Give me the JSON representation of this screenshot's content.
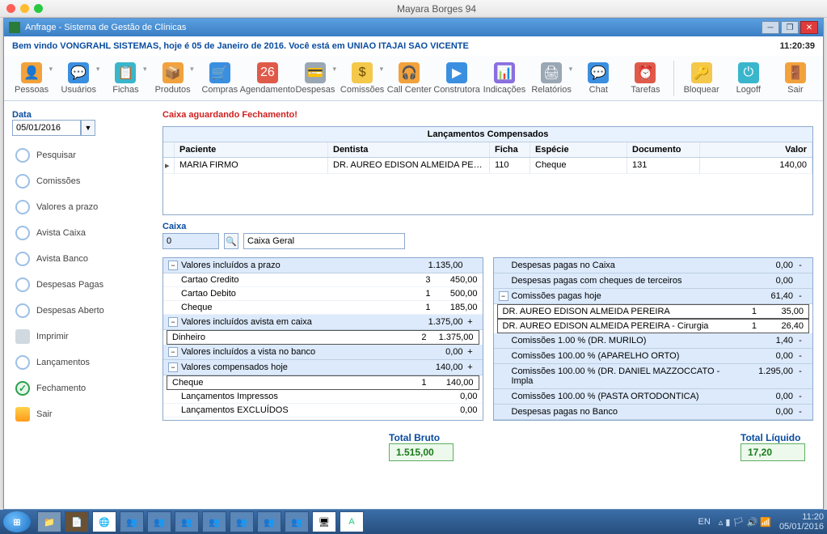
{
  "window": {
    "mac_title": "Mayara Borges 94",
    "app_title": "Anfrage - Sistema de Gestão de Clínicas"
  },
  "welcome": {
    "text": "Bem vindo VONGRAHL SISTEMAS, hoje é 05 de Janeiro de 2016. Você está em UNIAO ITAJAI SAO VICENTE",
    "clock": "11:20:39"
  },
  "toolbar": {
    "items": [
      {
        "label": "Pessoas",
        "icon": "people",
        "color": "ic-orange",
        "dd": true
      },
      {
        "label": "Usuários",
        "icon": "users",
        "color": "ic-blue",
        "dd": true
      },
      {
        "label": "Fichas",
        "icon": "fichas",
        "color": "ic-teal",
        "dd": true
      },
      {
        "label": "Produtos",
        "icon": "produtos",
        "color": "ic-orange",
        "dd": true
      },
      {
        "label": "Compras",
        "icon": "compras",
        "color": "ic-blue",
        "dd": false
      },
      {
        "label": "Agendamento",
        "icon": "agenda",
        "color": "ic-red",
        "dd": false
      },
      {
        "label": "Despesas",
        "icon": "despesas",
        "color": "ic-gray",
        "dd": true
      },
      {
        "label": "Comissões",
        "icon": "comissoes",
        "color": "ic-yellow",
        "dd": true
      },
      {
        "label": "Call Center",
        "icon": "call",
        "color": "ic-orange",
        "dd": false
      },
      {
        "label": "Construtora",
        "icon": "construtora",
        "color": "ic-blue",
        "dd": false
      },
      {
        "label": "Indicações",
        "icon": "indicacoes",
        "color": "ic-purple",
        "dd": false
      },
      {
        "label": "Relatórios",
        "icon": "relatorios",
        "color": "ic-gray",
        "dd": true
      },
      {
        "label": "Chat",
        "icon": "chat",
        "color": "ic-blue",
        "dd": false
      },
      {
        "label": "Tarefas",
        "icon": "tarefas",
        "color": "ic-red",
        "dd": false
      }
    ],
    "right": [
      {
        "label": "Bloquear",
        "icon": "lock",
        "color": "ic-yellow"
      },
      {
        "label": "Logoff",
        "icon": "logoff",
        "color": "ic-teal"
      },
      {
        "label": "Sair",
        "icon": "exit",
        "color": "ic-orange"
      }
    ]
  },
  "sidebar": {
    "date_label": "Data",
    "date_value": "05/01/2016",
    "items": [
      {
        "label": "Pesquisar"
      },
      {
        "label": "Comissões"
      },
      {
        "label": "Valores a prazo"
      },
      {
        "label": "Avista Caixa"
      },
      {
        "label": "Avista Banco"
      },
      {
        "label": "Despesas Pagas"
      },
      {
        "label": "Despesas Aberto"
      },
      {
        "label": "Imprimir",
        "print": true
      },
      {
        "label": "Lançamentos"
      },
      {
        "label": "Fechamento",
        "active": true
      },
      {
        "label": "Sair",
        "exit": true
      }
    ]
  },
  "alert": "Caixa aguardando Fechamento!",
  "grid": {
    "title": "Lançamentos Compensados",
    "headers": {
      "paciente": "Paciente",
      "dentista": "Dentista",
      "ficha": "Ficha",
      "especie": "Espécie",
      "documento": "Documento",
      "valor": "Valor"
    },
    "rows": [
      {
        "paciente": "MARIA FIRMO",
        "dentista": "DR. AUREO EDISON ALMEIDA PEREIRA",
        "ficha": "110",
        "especie": "Cheque",
        "documento": "131",
        "valor": "140,00"
      }
    ]
  },
  "caixa": {
    "label": "Caixa",
    "num": "0",
    "nome": "Caixa Geral"
  },
  "left_panel": [
    {
      "type": "section",
      "label": "Valores incluídos a prazo",
      "value": "1.135,00",
      "op": ""
    },
    {
      "type": "line",
      "label": "Cartao Credito",
      "qty": "3",
      "value": "450,00"
    },
    {
      "type": "line",
      "label": "Cartao Debito",
      "qty": "1",
      "value": "500,00"
    },
    {
      "type": "line",
      "label": "Cheque",
      "qty": "1",
      "value": "185,00"
    },
    {
      "type": "section",
      "label": "Valores incluídos avista em caixa",
      "value": "1.375,00",
      "op": "+"
    },
    {
      "type": "line-boxed",
      "label": "Dinheiro",
      "qty": "2",
      "value": "1.375,00"
    },
    {
      "type": "section",
      "label": "Valores incluídos a vista no banco",
      "value": "0,00",
      "op": "+"
    },
    {
      "type": "section",
      "label": "Valores compensados hoje",
      "value": "140,00",
      "op": "+"
    },
    {
      "type": "line-boxed",
      "label": "Cheque",
      "qty": "1",
      "value": "140,00"
    },
    {
      "type": "plain",
      "label": "Lançamentos Impressos",
      "value": "0,00"
    },
    {
      "type": "plain",
      "label": "Lançamentos EXCLUÍDOS",
      "value": "0,00"
    }
  ],
  "right_panel": [
    {
      "type": "section-noc",
      "label": "Despesas pagas no Caixa",
      "value": "0,00",
      "op": "-"
    },
    {
      "type": "section-noc",
      "label": "Despesas pagas com cheques de terceiros",
      "value": "0,00",
      "op": ""
    },
    {
      "type": "section",
      "label": "Comissões pagas hoje",
      "value": "61,40",
      "op": "-"
    },
    {
      "type": "line-boxed",
      "label": "DR. AUREO EDISON ALMEIDA PEREIRA",
      "qty": "1",
      "value": "35,00"
    },
    {
      "type": "line-boxed",
      "label": "DR. AUREO EDISON ALMEIDA PEREIRA - Cirurgia",
      "qty": "1",
      "value": "26,40"
    },
    {
      "type": "section-noc",
      "label": "Comissões 1.00 % (DR. MURILO)",
      "value": "1,40",
      "op": "-"
    },
    {
      "type": "section-noc",
      "label": "Comissões 100.00 % (APARELHO ORTO)",
      "value": "0,00",
      "op": "-"
    },
    {
      "type": "section-noc",
      "label": "Comissões 100.00 % (DR. DANIEL MAZZOCCATO - Impla",
      "value": "1.295,00",
      "op": "-"
    },
    {
      "type": "section-noc",
      "label": "Comissões 100.00 % (PASTA ORTODONTICA)",
      "value": "0,00",
      "op": "-"
    },
    {
      "type": "section-noc",
      "label": "Despesas pagas no Banco",
      "value": "0,00",
      "op": "-"
    }
  ],
  "totals": {
    "bruto_label": "Total Bruto",
    "bruto": "1.515,00",
    "liquido_label": "Total Líquido",
    "liquido": "17,20"
  },
  "taskbar": {
    "lang": "EN",
    "time": "11:20",
    "date": "05/01/2016"
  }
}
